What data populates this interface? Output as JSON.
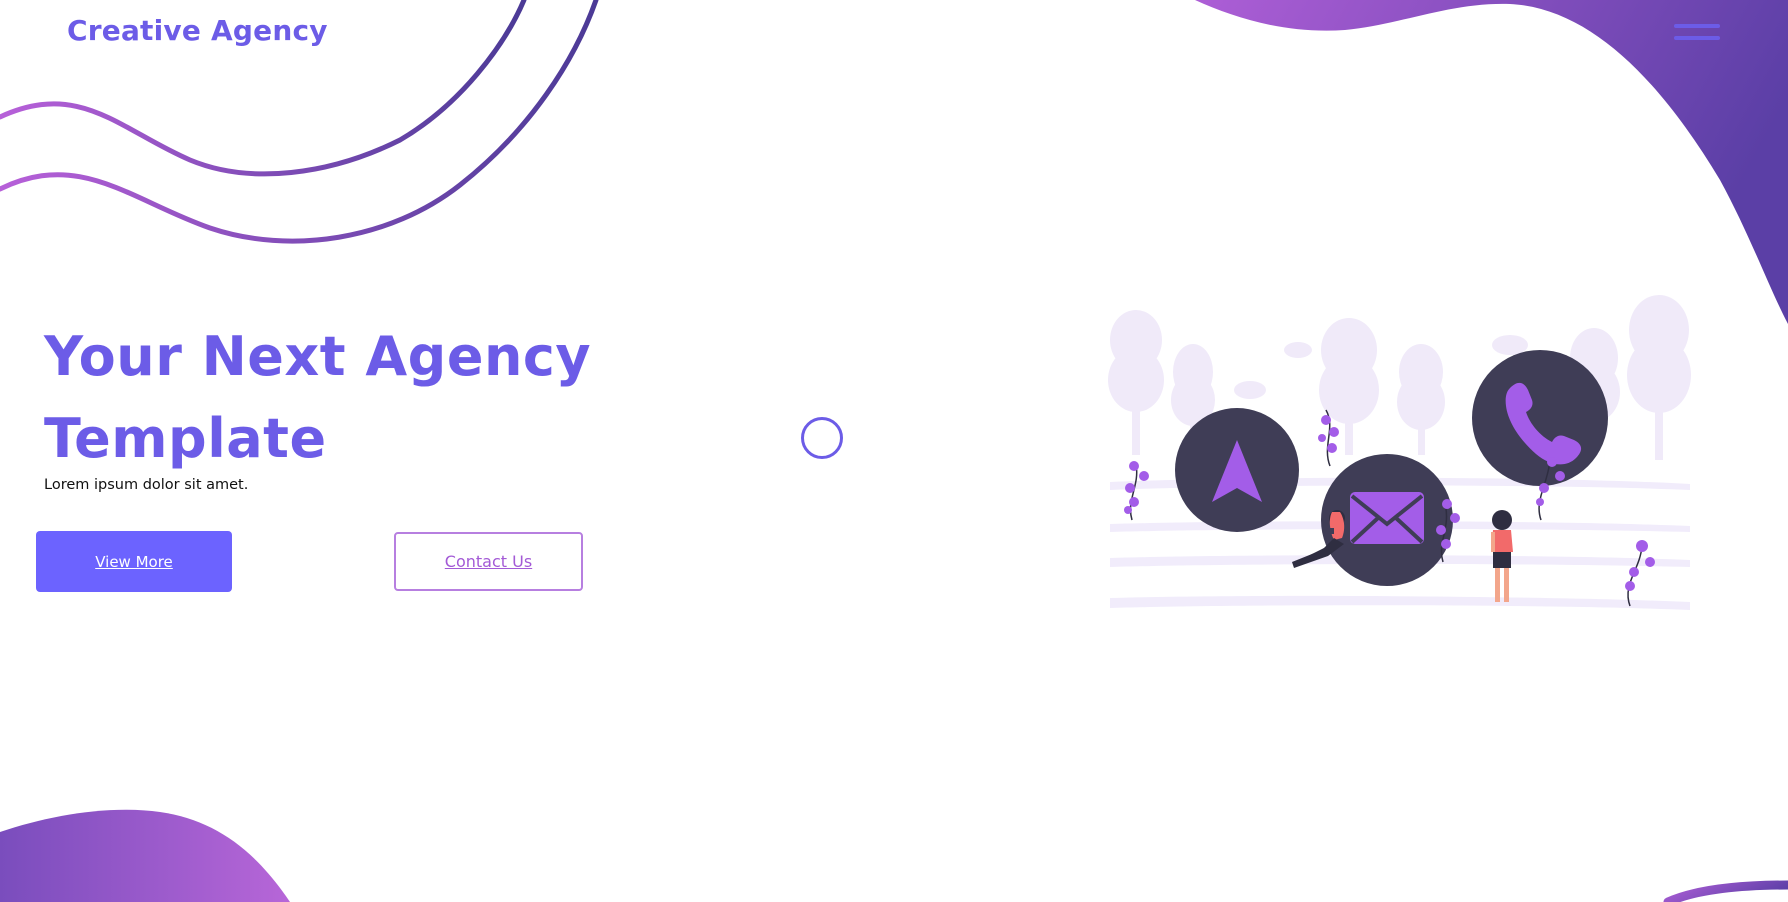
{
  "header": {
    "logo": "Creative Agency",
    "menu_icon": "hamburger-menu-icon"
  },
  "hero": {
    "title": "Your Next Agency Template",
    "subtitle": "Lorem ipsum dolor sit amet.",
    "primary_button": "View More",
    "secondary_button": "Contact Us"
  },
  "illustration": {
    "icons": [
      "navigation-arrow-icon",
      "mail-envelope-icon",
      "phone-icon"
    ]
  },
  "colors": {
    "primary": "#6c5ce7",
    "button": "#6c63ff",
    "accent": "#a35ad6",
    "gradient_light": "#ad5ed6",
    "gradient_dark": "#5b3fa6",
    "circle_dark": "#3f3d56"
  }
}
